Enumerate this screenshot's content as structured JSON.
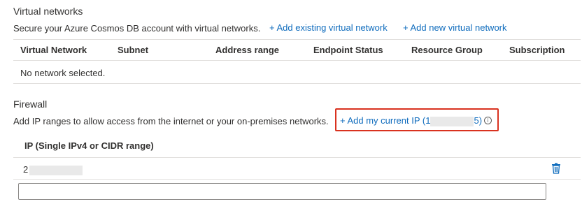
{
  "virtual_networks": {
    "title": "Virtual networks",
    "description": "Secure your Azure Cosmos DB account with virtual networks.",
    "add_existing_label": "+ Add existing virtual network",
    "add_new_label": "+ Add new virtual network",
    "columns": [
      "Virtual Network",
      "Subnet",
      "Address range",
      "Endpoint Status",
      "Resource Group",
      "Subscription"
    ],
    "empty_message": "No network selected."
  },
  "firewall": {
    "title": "Firewall",
    "description": "Add IP ranges to allow access from the internet or your on-premises networks.",
    "add_ip_prefix": "+ Add my current IP (1",
    "add_ip_suffix": "5)",
    "column_header": "IP (Single IPv4 or CIDR range)",
    "row_ip_visible": "2",
    "new_ip_value": "",
    "accent_color": "#0f6cbd",
    "highlight_color": "#d9321f",
    "icons": [
      "info-icon",
      "trash-icon"
    ]
  }
}
